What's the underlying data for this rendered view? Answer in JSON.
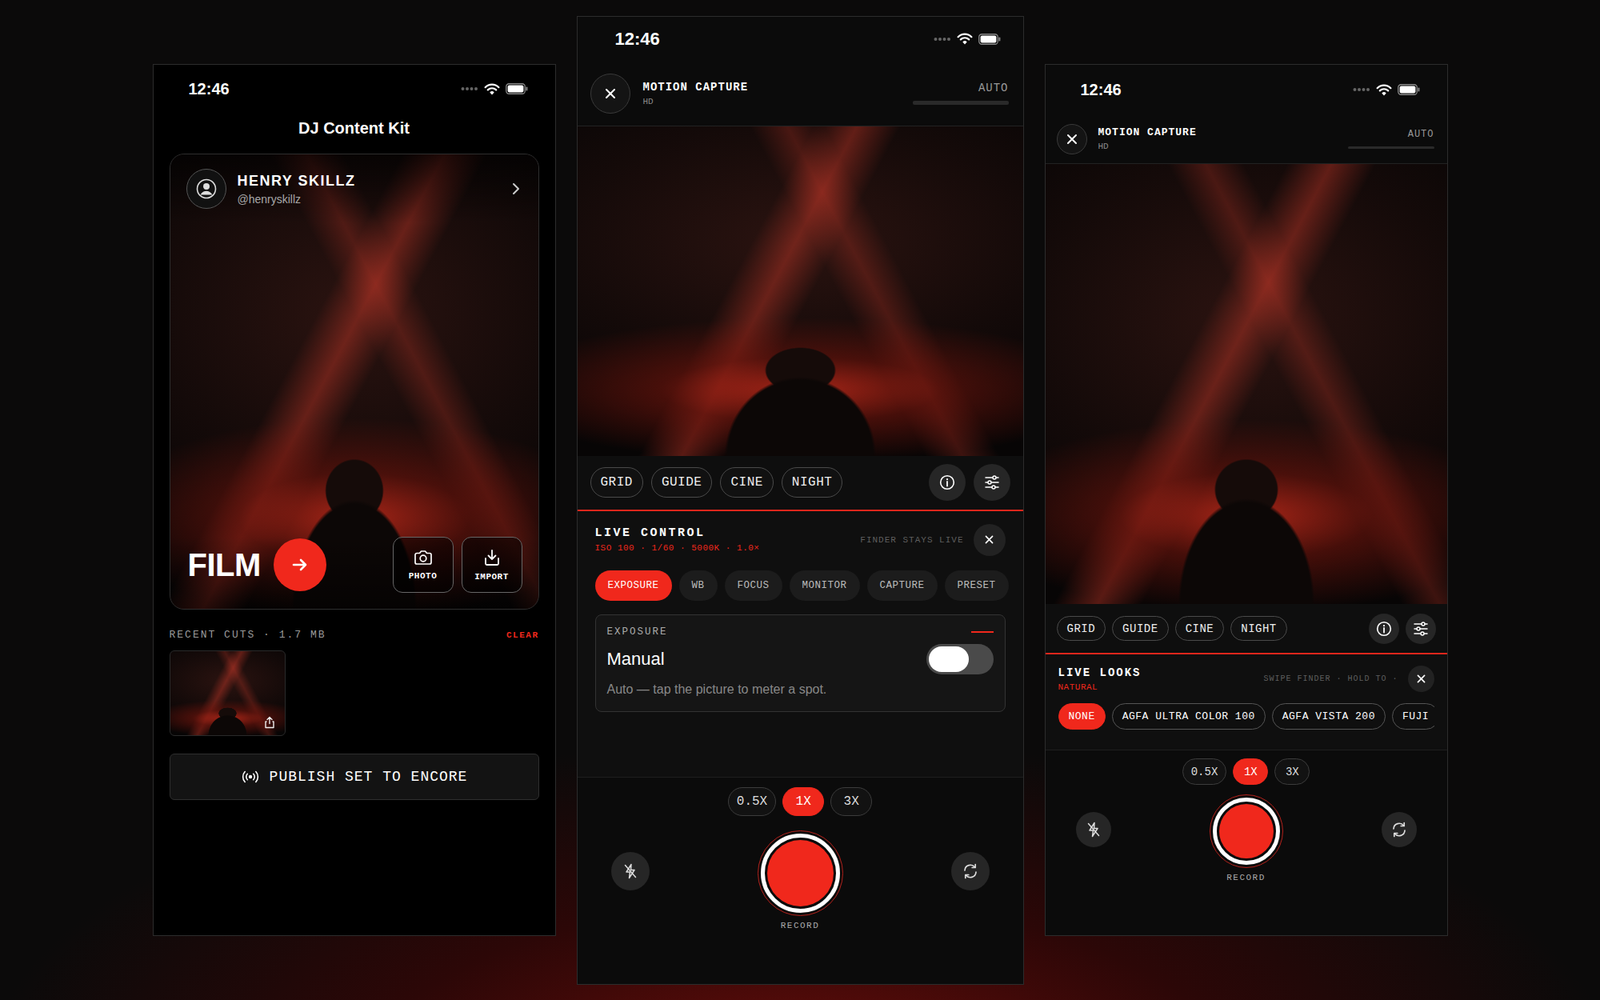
{
  "home": {
    "status": {
      "time": "12:46"
    },
    "title": "DJ Content Kit",
    "profile": {
      "name": "HENRY SKILLZ",
      "handle": "@henryskillz"
    },
    "film": {
      "label": "FILM"
    },
    "actions": [
      {
        "kind": "photo",
        "label": "PHOTO"
      },
      {
        "kind": "import",
        "label": "IMPORT"
      }
    ],
    "recent": {
      "label": "RECENT CUTS · 1.7 MB",
      "clear": "CLEAR",
      "clips": [
        {
          "shareable": true
        }
      ]
    },
    "publish": "PUBLISH SET TO ENCORE"
  },
  "cameras": [
    {
      "status": {
        "time": "12:46"
      },
      "header": {
        "title": "MOTION CAPTURE",
        "quality": "HD",
        "mode": "AUTO"
      },
      "modes": [
        {
          "label": "GRID",
          "selected": false
        },
        {
          "label": "GUIDE",
          "selected": false
        },
        {
          "label": "CINE",
          "selected": false
        },
        {
          "label": "NIGHT",
          "selected": false
        }
      ],
      "panel": {
        "kind": "control",
        "title": "LIVE CONTROL",
        "subtitle": "ISO 100 · 1/60 · 5000K · 1.0×",
        "hint": "FINDER STAYS LIVE",
        "tabs": [
          {
            "label": "EXPOSURE",
            "selected": true
          },
          {
            "label": "WB",
            "selected": false
          },
          {
            "label": "FOCUS",
            "selected": false
          },
          {
            "label": "MONITOR",
            "selected": false
          },
          {
            "label": "CAPTURE",
            "selected": false
          },
          {
            "label": "PRESET",
            "selected": false
          }
        ],
        "setting": {
          "label": "EXPOSURE",
          "value": "Manual",
          "on": false,
          "description": "Auto — tap the picture to meter a spot."
        }
      },
      "zoom": [
        {
          "label": "0.5X",
          "selected": false
        },
        {
          "label": "1X",
          "selected": true
        },
        {
          "label": "3X",
          "selected": false
        }
      ],
      "record": "RECORD"
    },
    {
      "status": {
        "time": "12:46"
      },
      "header": {
        "title": "MOTION CAPTURE",
        "quality": "HD",
        "mode": "AUTO"
      },
      "modes": [
        {
          "label": "GRID",
          "selected": false
        },
        {
          "label": "GUIDE",
          "selected": false
        },
        {
          "label": "CINE",
          "selected": false
        },
        {
          "label": "NIGHT",
          "selected": false
        }
      ],
      "panel": {
        "kind": "looks",
        "title": "LIVE LOOKS",
        "subtitle": "NATURAL",
        "hint": "SWIPE FINDER · HOLD TO ·",
        "looks": [
          {
            "label": "NONE",
            "selected": true
          },
          {
            "label": "AGFA ULTRA COLOR 100",
            "selected": false
          },
          {
            "label": "AGFA VISTA 200",
            "selected": false
          },
          {
            "label": "FUJI",
            "selected": false
          }
        ]
      },
      "zoom": [
        {
          "label": "0.5X",
          "selected": false
        },
        {
          "label": "1X",
          "selected": true
        },
        {
          "label": "3X",
          "selected": false
        }
      ],
      "record": "RECORD"
    }
  ]
}
